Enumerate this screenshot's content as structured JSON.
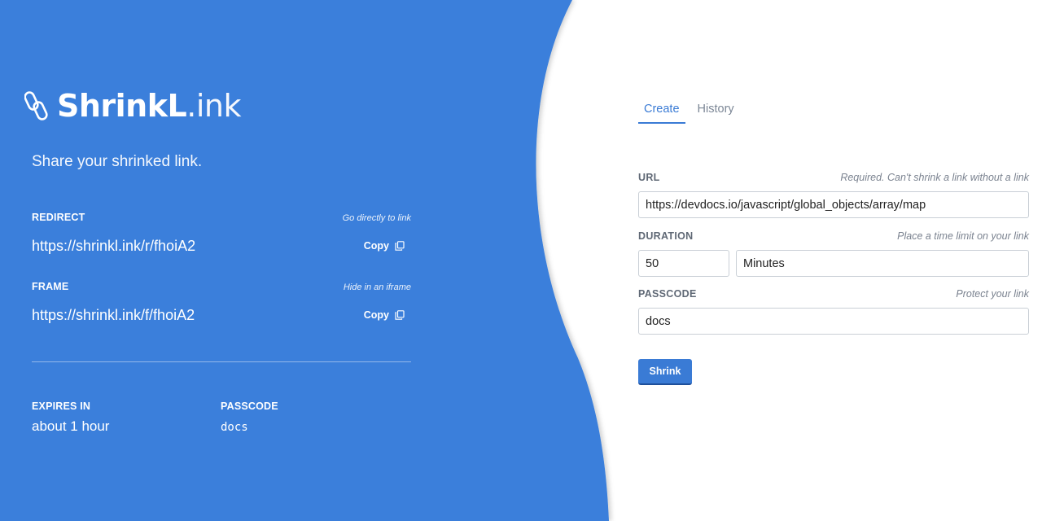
{
  "brand": {
    "name_bold": "ShrinkL",
    "name_light": ".ink"
  },
  "tagline": "Share your shrinked link.",
  "redirect": {
    "label": "REDIRECT",
    "hint": "Go directly to link",
    "url": "https://shrinkl.ink/r/fhoiA2",
    "copy_label": "Copy"
  },
  "frame": {
    "label": "FRAME",
    "hint": "Hide in an iframe",
    "url": "https://shrinkl.ink/f/fhoiA2",
    "copy_label": "Copy"
  },
  "expires": {
    "label": "EXPIRES IN",
    "value": "about 1 hour"
  },
  "passcode_info": {
    "label": "PASSCODE",
    "value": "docs"
  },
  "tabs": [
    {
      "label": "Create",
      "active": true
    },
    {
      "label": "History",
      "active": false
    }
  ],
  "form": {
    "url": {
      "label": "URL",
      "hint": "Required. Can't shrink a link without a link",
      "value": "https://devdocs.io/javascript/global_objects/array/map"
    },
    "duration": {
      "label": "DURATION",
      "hint": "Place a time limit on your link",
      "amount": "50",
      "unit": "Minutes"
    },
    "passcode": {
      "label": "PASSCODE",
      "hint": "Protect your link",
      "value": "docs"
    },
    "submit_label": "Shrink"
  },
  "colors": {
    "primary": "#3a7bd5",
    "background": "#ffffff"
  },
  "icons": {
    "logo": "paperclip-icon",
    "copy": "copy-icon"
  }
}
